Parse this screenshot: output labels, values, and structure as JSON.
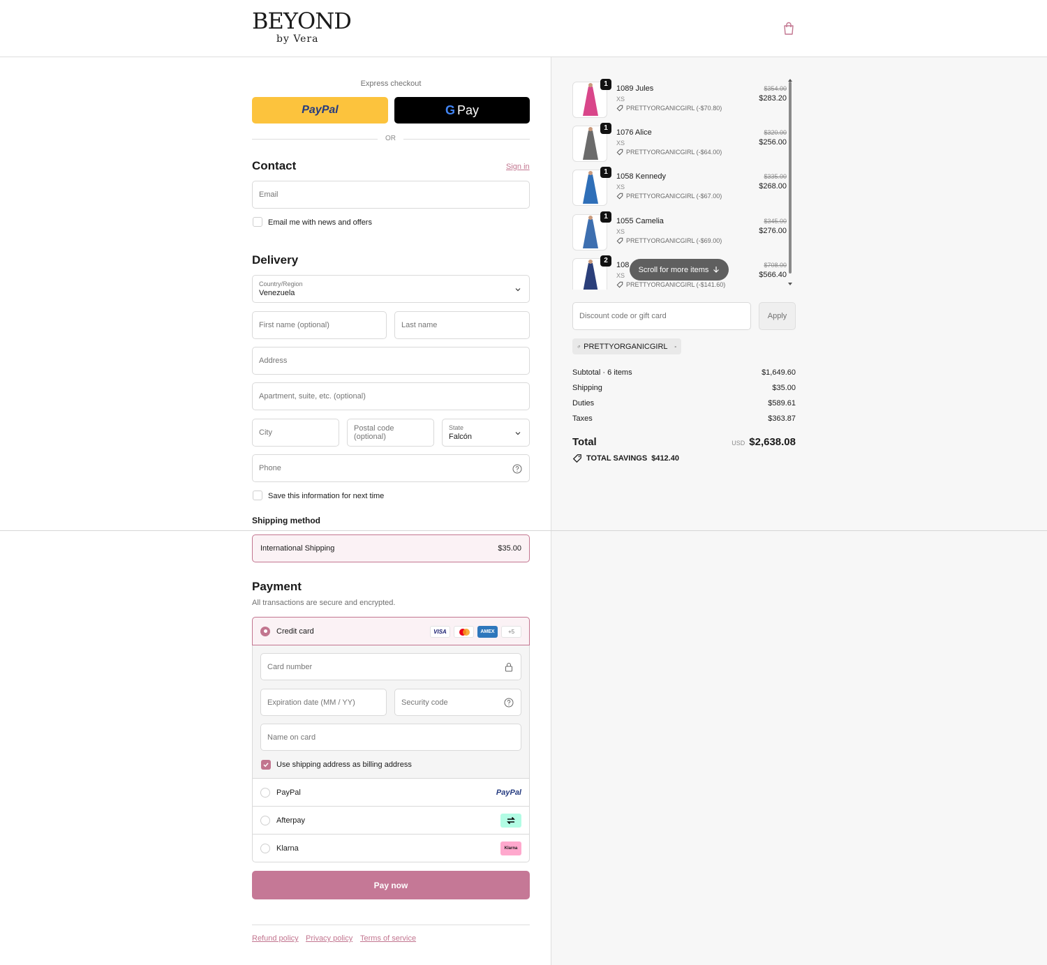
{
  "brand": {
    "name": "BEYOND",
    "sub": "by Vera"
  },
  "express": {
    "label": "Express checkout",
    "paypal": "PayPal",
    "gpay": "Pay",
    "or": "OR"
  },
  "contact": {
    "title": "Contact",
    "signin": "Sign in",
    "email_placeholder": "Email",
    "news_label": "Email me with news and offers"
  },
  "delivery": {
    "title": "Delivery",
    "country_label": "Country/Region",
    "country_value": "Venezuela",
    "first_name": "First name (optional)",
    "last_name": "Last name",
    "address": "Address",
    "apartment": "Apartment, suite, etc. (optional)",
    "city": "City",
    "postal": "Postal code (optional)",
    "state_label": "State",
    "state_value": "Falcón",
    "phone": "Phone",
    "save_label": "Save this information for next time"
  },
  "shipping": {
    "title": "Shipping method",
    "method": "International Shipping",
    "price": "$35.00"
  },
  "payment": {
    "title": "Payment",
    "subtitle": "All transactions are secure and encrypted.",
    "credit_card": "Credit card",
    "cards": [
      "VISA",
      "AMEX",
      "+5"
    ],
    "card_number": "Card number",
    "expiration": "Expiration date (MM / YY)",
    "security": "Security code",
    "name_on_card": "Name on card",
    "billing_label": "Use shipping address as billing address",
    "paypal": "PayPal",
    "paypal_logo": "PayPal",
    "afterpay": "Afterpay",
    "klarna": "Klarna",
    "klarna_logo": "Klarna",
    "pay_now": "Pay now"
  },
  "footer": {
    "refund": "Refund policy",
    "privacy": "Privacy policy",
    "terms": "Terms of service"
  },
  "cart": {
    "items": [
      {
        "qty": "1",
        "name": "1089 Jules",
        "size": "XS",
        "code": "PRETTYORGANICGIRL (-$70.80)",
        "old": "$354.00",
        "price": "$283.20",
        "color": "#d9468a"
      },
      {
        "qty": "1",
        "name": "1076 Alice",
        "size": "XS",
        "code": "PRETTYORGANICGIRL (-$64.00)",
        "old": "$320.00",
        "price": "$256.00",
        "color": "#6b6b6b"
      },
      {
        "qty": "1",
        "name": "1058 Kennedy",
        "size": "XS",
        "code": "PRETTYORGANICGIRL (-$67.00)",
        "old": "$335.00",
        "price": "$268.00",
        "color": "#2f6fb8"
      },
      {
        "qty": "1",
        "name": "1055 Camelia",
        "size": "XS",
        "code": "PRETTYORGANICGIRL (-$69.00)",
        "old": "$345.00",
        "price": "$276.00",
        "color": "#3d6fb0"
      },
      {
        "qty": "2",
        "name": "108",
        "size": "XS",
        "code": "PRETTYORGANICGIRL (-$141.60)",
        "old": "$708.00",
        "price": "$566.40",
        "color": "#2b3f7a"
      }
    ],
    "scroll_hint": "Scroll for more items"
  },
  "discount": {
    "placeholder": "Discount code or gift card",
    "apply": "Apply",
    "applied_code": "PRETTYORGANICGIRL"
  },
  "summary": {
    "subtotal_label": "Subtotal · 6 items",
    "subtotal": "$1,649.60",
    "shipping_label": "Shipping",
    "shipping": "$35.00",
    "duties_label": "Duties",
    "duties": "$589.61",
    "taxes_label": "Taxes",
    "taxes": "$363.87",
    "total_label": "Total",
    "currency": "USD",
    "total": "$2,638.08",
    "savings_label": "TOTAL SAVINGS",
    "savings": "$412.40"
  },
  "colors": {
    "accent": "#c2758f",
    "paypal_yellow": "#fcc33d",
    "paypal_blue": "#253b80",
    "paypal_light": "#179bd7",
    "afterpay": "#b2fce4",
    "klarna": "#ffa8cd"
  }
}
